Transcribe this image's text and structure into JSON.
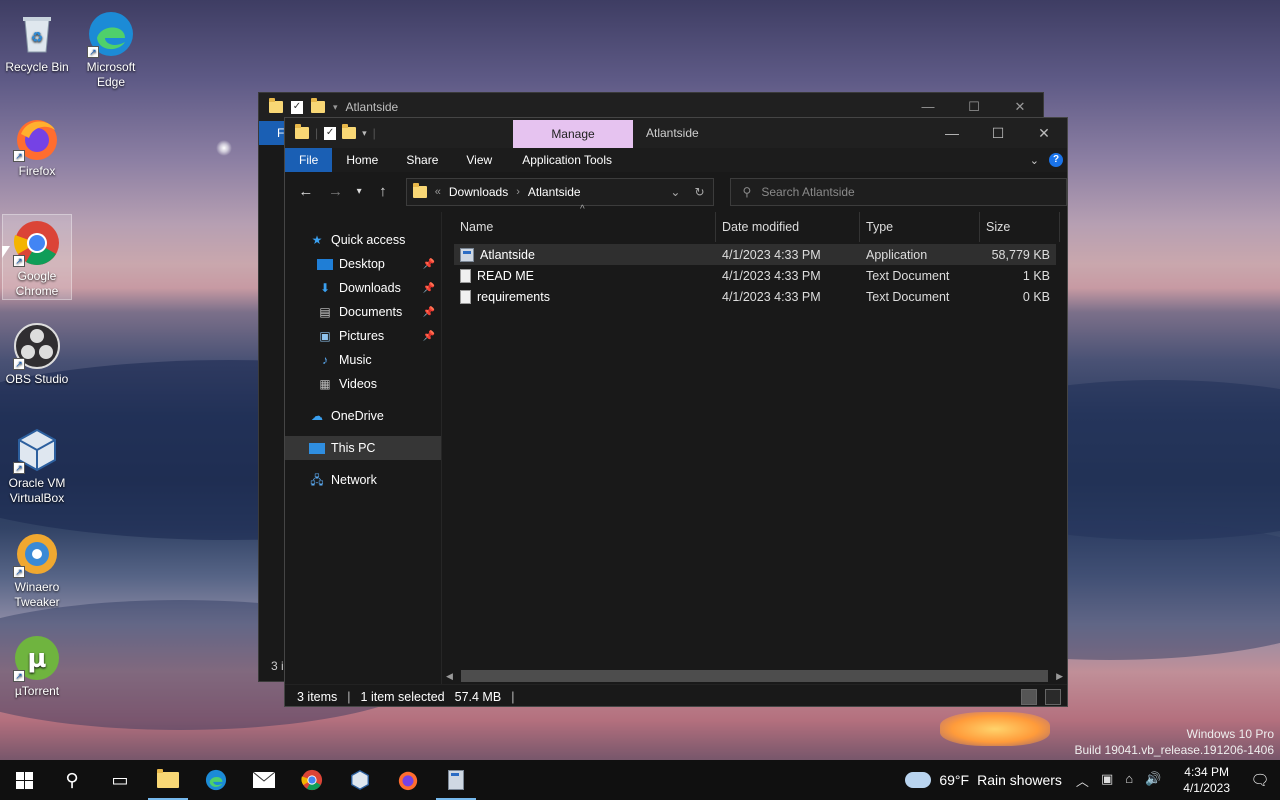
{
  "desktop": {
    "icons": [
      {
        "label": "Recycle Bin",
        "icon": "recycle-bin-icon"
      },
      {
        "label": "Microsoft Edge",
        "icon": "edge-icon"
      },
      {
        "label": "Firefox",
        "icon": "firefox-icon"
      },
      {
        "label": "Google Chrome",
        "icon": "chrome-icon"
      },
      {
        "label": "OBS Studio",
        "icon": "obs-icon"
      },
      {
        "label": "Oracle VM VirtualBox",
        "icon": "virtualbox-icon"
      },
      {
        "label": "Winaero Tweaker",
        "icon": "winaero-icon"
      },
      {
        "label": "µTorrent",
        "icon": "utorrent-icon"
      }
    ]
  },
  "back_window": {
    "title": "Atlantside",
    "tab": "F",
    "status": "3 i"
  },
  "window": {
    "title": "Atlantside",
    "manage_tab": "Manage",
    "ribbon_tabs": [
      "File",
      "Home",
      "Share",
      "View",
      "Application Tools"
    ],
    "address": {
      "parts": [
        "Downloads",
        "Atlantside"
      ],
      "prefix": "«"
    },
    "search_placeholder": "Search Atlantside",
    "nav": {
      "quick_access": "Quick access",
      "pinned": [
        "Desktop",
        "Downloads",
        "Documents",
        "Pictures"
      ],
      "unpinned": [
        "Music",
        "Videos"
      ],
      "onedrive": "OneDrive",
      "this_pc": "This PC",
      "network": "Network"
    },
    "columns": [
      "Name",
      "Date modified",
      "Type",
      "Size"
    ],
    "files": [
      {
        "name": "Atlantside",
        "date": "4/1/2023 4:33 PM",
        "type": "Application",
        "size": "58,779 KB",
        "icon": "application-icon"
      },
      {
        "name": "READ ME",
        "date": "4/1/2023 4:33 PM",
        "type": "Text Document",
        "size": "1 KB",
        "icon": "text-document-icon"
      },
      {
        "name": "requirements",
        "date": "4/1/2023 4:33 PM",
        "type": "Text Document",
        "size": "0 KB",
        "icon": "text-document-icon"
      }
    ],
    "status": {
      "items": "3 items",
      "selected": "1 item selected",
      "size": "57.4 MB"
    }
  },
  "watermark": {
    "line1": "Windows 10 Pro",
    "line2": "Build 19041.vb_release.191206-1406"
  },
  "taskbar": {
    "weather": {
      "temp": "69°F",
      "desc": "Rain showers"
    },
    "time": "4:34 PM",
    "date": "4/1/2023"
  },
  "colors": {
    "accent": "#1a5fb4",
    "manage_tab": "#e6c3f0",
    "taskbar": "#101010"
  }
}
